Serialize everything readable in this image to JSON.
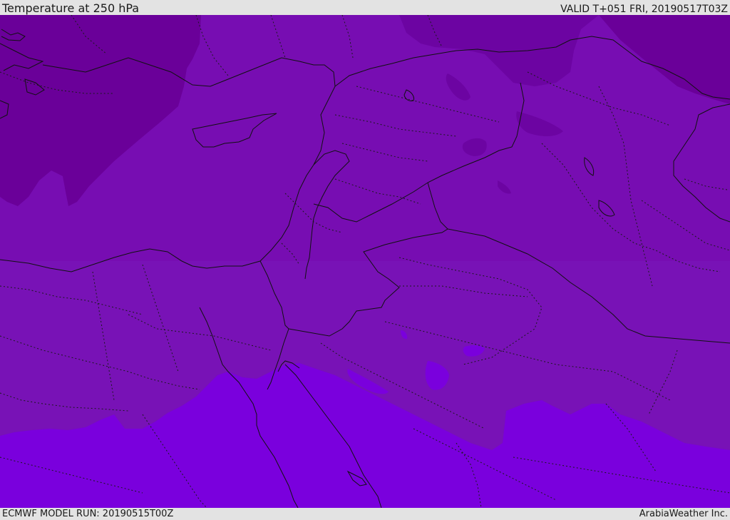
{
  "header": {
    "title": "Temperature at 250 hPa",
    "valid": "VALID T+051 FRI, 20190517T03Z"
  },
  "footer": {
    "model_run": "ECMWF MODEL RUN: 20190515T00Z",
    "credit": "ArabiaWeather Inc."
  },
  "map": {
    "colors": {
      "band_coldest": "#6a0099",
      "band_cold": "#770db2",
      "band_mid": "#7810b8",
      "band_warm": "#7a00dd",
      "border_line": "#111111",
      "province_line": "#1a1a1a"
    }
  }
}
